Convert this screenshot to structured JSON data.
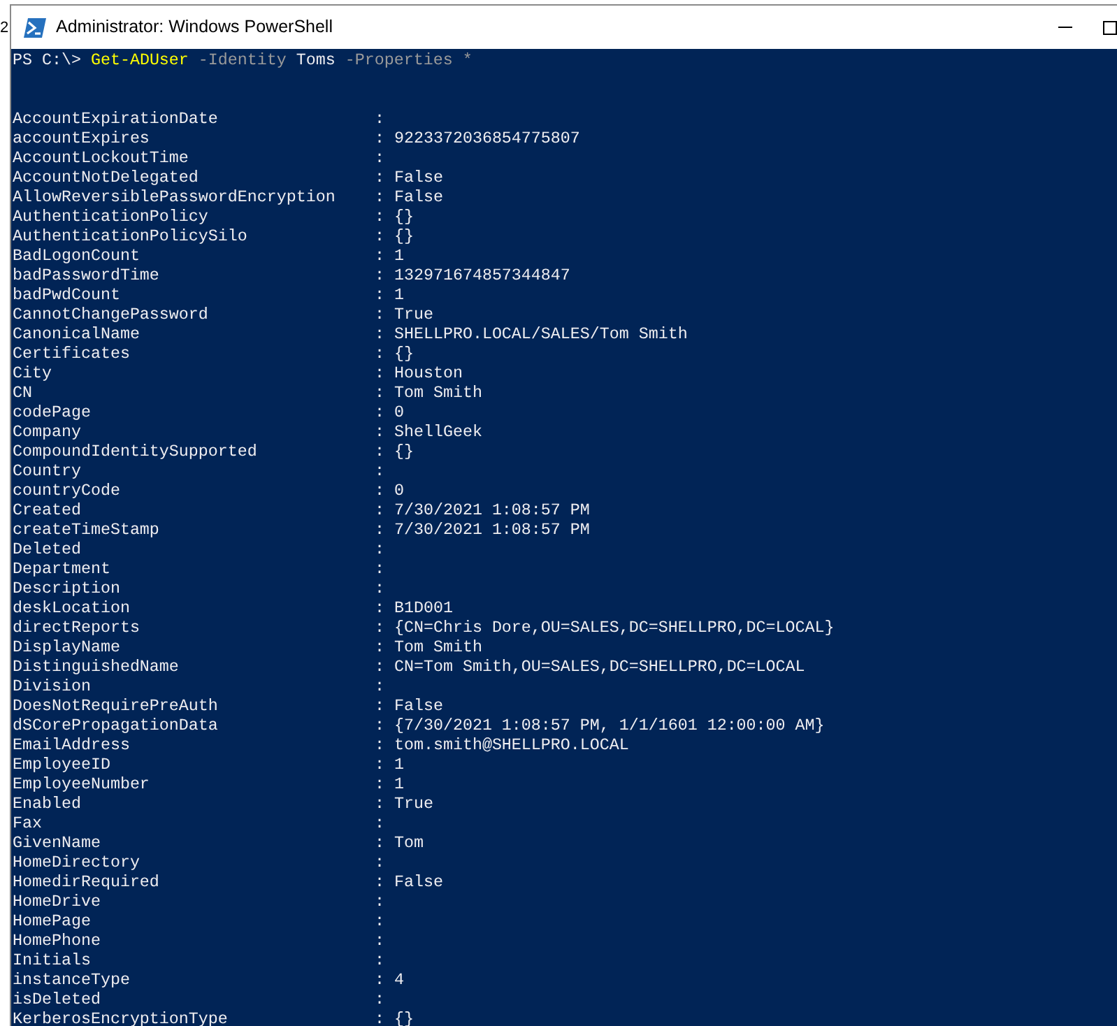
{
  "background_texts": [
    {
      "text": "2",
      "kind": "left-upper"
    }
  ],
  "window": {
    "title": "Administrator: Windows PowerShell"
  },
  "prompt": [
    {
      "kind": "prompt",
      "text": "PS C:\\>"
    },
    {
      "kind": "command",
      "text": "Get-ADUser"
    },
    {
      "kind": "parameter",
      "text": "-Identity"
    },
    {
      "kind": "argument",
      "text": "Toms"
    },
    {
      "kind": "parameter",
      "text": "-Properties"
    },
    {
      "kind": "parameter",
      "text": "*"
    }
  ],
  "properties": [
    {
      "name": "AccountExpirationDate",
      "value": ":"
    },
    {
      "name": "accountExpires",
      "value": ": 9223372036854775807"
    },
    {
      "name": "AccountLockoutTime",
      "value": ":"
    },
    {
      "name": "AccountNotDelegated",
      "value": ": False"
    },
    {
      "name": "AllowReversiblePasswordEncryption",
      "value": ": False"
    },
    {
      "name": "AuthenticationPolicy",
      "value": ": {}"
    },
    {
      "name": "AuthenticationPolicySilo",
      "value": ": {}"
    },
    {
      "name": "BadLogonCount",
      "value": ": 1"
    },
    {
      "name": "badPasswordTime",
      "value": ": 132971674857344847"
    },
    {
      "name": "badPwdCount",
      "value": ": 1"
    },
    {
      "name": "CannotChangePassword",
      "value": ": True"
    },
    {
      "name": "CanonicalName",
      "value": ": SHELLPRO.LOCAL/SALES/Tom Smith"
    },
    {
      "name": "Certificates",
      "value": ": {}"
    },
    {
      "name": "City",
      "value": ": Houston"
    },
    {
      "name": "CN",
      "value": ": Tom Smith"
    },
    {
      "name": "codePage",
      "value": ": 0"
    },
    {
      "name": "Company",
      "value": ": ShellGeek"
    },
    {
      "name": "CompoundIdentitySupported",
      "value": ": {}"
    },
    {
      "name": "Country",
      "value": ":"
    },
    {
      "name": "countryCode",
      "value": ": 0"
    },
    {
      "name": "Created",
      "value": ": 7/30/2021 1:08:57 PM"
    },
    {
      "name": "createTimeStamp",
      "value": ": 7/30/2021 1:08:57 PM"
    },
    {
      "name": "Deleted",
      "value": ":"
    },
    {
      "name": "Department",
      "value": ":"
    },
    {
      "name": "Description",
      "value": ":"
    },
    {
      "name": "deskLocation",
      "value": ": B1D001"
    },
    {
      "name": "directReports",
      "value": ": {CN=Chris Dore,OU=SALES,DC=SHELLPRO,DC=LOCAL}"
    },
    {
      "name": "DisplayName",
      "value": ": Tom Smith"
    },
    {
      "name": "DistinguishedName",
      "value": ": CN=Tom Smith,OU=SALES,DC=SHELLPRO,DC=LOCAL"
    },
    {
      "name": "Division",
      "value": ":"
    },
    {
      "name": "DoesNotRequirePreAuth",
      "value": ": False"
    },
    {
      "name": "dSCorePropagationData",
      "value": ": {7/30/2021 1:08:57 PM, 1/1/1601 12:00:00 AM}"
    },
    {
      "name": "EmailAddress",
      "value": ": tom.smith@SHELLPRO.LOCAL"
    },
    {
      "name": "EmployeeID",
      "value": ": 1"
    },
    {
      "name": "EmployeeNumber",
      "value": ": 1"
    },
    {
      "name": "Enabled",
      "value": ": True"
    },
    {
      "name": "Fax",
      "value": ":"
    },
    {
      "name": "GivenName",
      "value": ": Tom"
    },
    {
      "name": "HomeDirectory",
      "value": ":"
    },
    {
      "name": "HomedirRequired",
      "value": ": False"
    },
    {
      "name": "HomeDrive",
      "value": ":"
    },
    {
      "name": "HomePage",
      "value": ":"
    },
    {
      "name": "HomePhone",
      "value": ":"
    },
    {
      "name": "Initials",
      "value": ":"
    },
    {
      "name": "instanceType",
      "value": ": 4"
    },
    {
      "name": "isDeleted",
      "value": ":"
    },
    {
      "name": "KerberosEncryptionType",
      "value": ": {}"
    }
  ]
}
